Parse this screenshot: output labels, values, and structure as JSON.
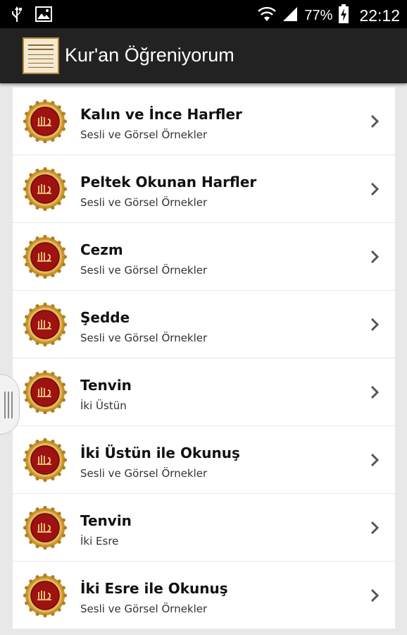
{
  "status_bar": {
    "battery_percent": "77%",
    "time": "22:12",
    "icons": [
      "usb-icon",
      "image-icon",
      "wifi-icon",
      "signal-icon",
      "battery-charging-icon"
    ]
  },
  "action_bar": {
    "title": "Kur'an Öğreniyorum",
    "logo_icon": "quran-book-logo"
  },
  "list": {
    "items": [
      {
        "title": "Kalın ve İnce Harfler",
        "subtitle": "Sesli ve Görsel Örnekler"
      },
      {
        "title": "Peltek Okunan Harfler",
        "subtitle": "Sesli ve Görsel Örnekler"
      },
      {
        "title": "Cezm",
        "subtitle": "Sesli ve Görsel Örnekler"
      },
      {
        "title": "Şedde",
        "subtitle": "Sesli ve Görsel Örnekler"
      },
      {
        "title": "Tenvin",
        "subtitle": "İki Üstün"
      },
      {
        "title": "İki Üstün ile Okunuş",
        "subtitle": "Sesli ve Görsel Örnekler"
      },
      {
        "title": "Tenvin",
        "subtitle": "İki Esre"
      },
      {
        "title": "İki Esre ile Okunuş",
        "subtitle": "Sesli ve Görsel Örnekler"
      }
    ]
  },
  "colors": {
    "status_bar": "#000000",
    "action_bar": "#222222",
    "list_background": "#e8e8e8",
    "row_background": "#ffffff",
    "medallion_gold": "#c9962e",
    "medallion_red": "#9e1212"
  }
}
